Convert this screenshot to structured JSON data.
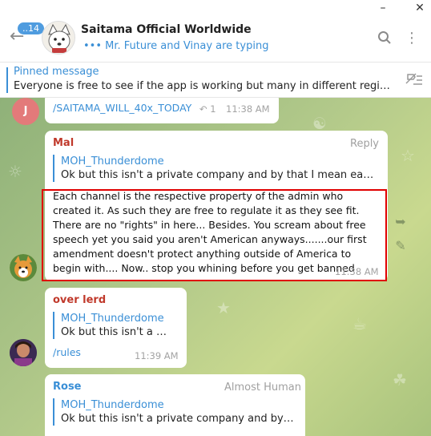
{
  "header": {
    "unread_badge": "14",
    "chat_title": "Saitama Official Worldwide",
    "typing_status": "Mr. Future and Vinay are typing"
  },
  "pinned": {
    "title": "Pinned message",
    "text": "Everyone is free to see if the app is working but many in different regions it's..."
  },
  "messages": [
    {
      "avatar_letter": "J",
      "link_text": "/SAITAMA_WILL_40x_TODAY",
      "reply_count": "1",
      "time": "11:38 AM"
    },
    {
      "sender": "Mal",
      "reply_label": "Reply",
      "quote_name": "MOH_Thunderdome",
      "quote_text": "Ok but this isn't a private company and by that I mean each cha...",
      "text": "Each channel is the respective property of the admin who created it. As such they are free to regulate it as they see fit.   There are no \"rights\" in here... Besides. You scream about free speech yet you said you aren't American anyways.......our first amendment doesn't protect anything outside of America to begin with....   Now.. stop you whining before you get banned",
      "time": "11:38 AM"
    },
    {
      "sender": "over lerd",
      "quote_name": "MOH_Thunderdome",
      "quote_text": "Ok but this isn't a priv...",
      "link_text": "/rules",
      "time": "11:39 AM"
    },
    {
      "sender": "Rose",
      "role": "Almost Human",
      "quote_name": "MOH_Thunderdome",
      "quote_text": "Ok but this isn't a private company and by that ..."
    }
  ],
  "colors": {
    "accent": "#3a8fd6",
    "sender_mal": "#c0392b",
    "sender_overlerd": "#c0392b",
    "sender_rose": "#3a8fd6",
    "highlight": "#e00000"
  }
}
